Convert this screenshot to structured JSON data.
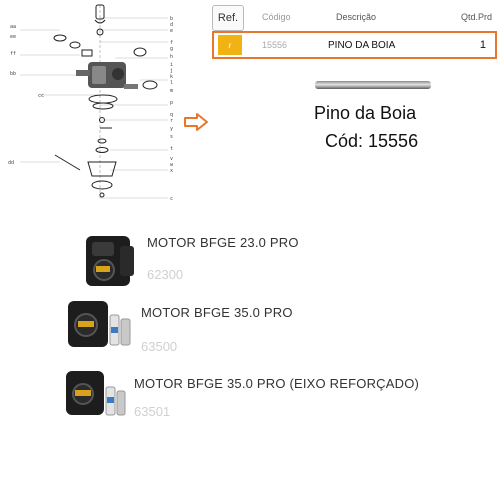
{
  "diagram": {
    "labels_right": [
      "b",
      "d",
      "e",
      "f",
      "g",
      "h",
      "i",
      "j",
      "k",
      "l",
      "m",
      "n",
      "o",
      "p",
      "q",
      "r",
      "s",
      "t",
      "u",
      "v",
      "w",
      "x",
      "c"
    ],
    "labels_left": [
      "aa",
      "bb",
      "cc",
      "dd",
      "ee",
      "ff"
    ],
    "highlight_icon": "right-arrow-outline-icon"
  },
  "table": {
    "headers": {
      "ref": "Ref.",
      "code": "Código",
      "description": "Descrição",
      "qty": "Qtd.Prd"
    },
    "row": {
      "ref": "r",
      "code": "15556",
      "description": "PINO DA BOIA",
      "qty": "1"
    }
  },
  "part": {
    "title": "Pino da Boia",
    "code_line": "Cód: 15556",
    "image_icon": "pin-rod-icon"
  },
  "motors": [
    {
      "name": "MOTOR BFGE 23.0 PRO",
      "code": "62300",
      "icon": "engine-icon"
    },
    {
      "name": "MOTOR BFGE 35.0 PRO",
      "code": "63500",
      "icon": "engine-with-filter-icon"
    },
    {
      "name": "MOTOR BFGE 35.0 PRO (EIXO REFORÇADO)",
      "code": "63501",
      "icon": "engine-with-filter-icon"
    }
  ],
  "colors": {
    "accent": "#e8772e",
    "ref_badge": "#f1b213",
    "code_gray": "#d0d0d0"
  }
}
